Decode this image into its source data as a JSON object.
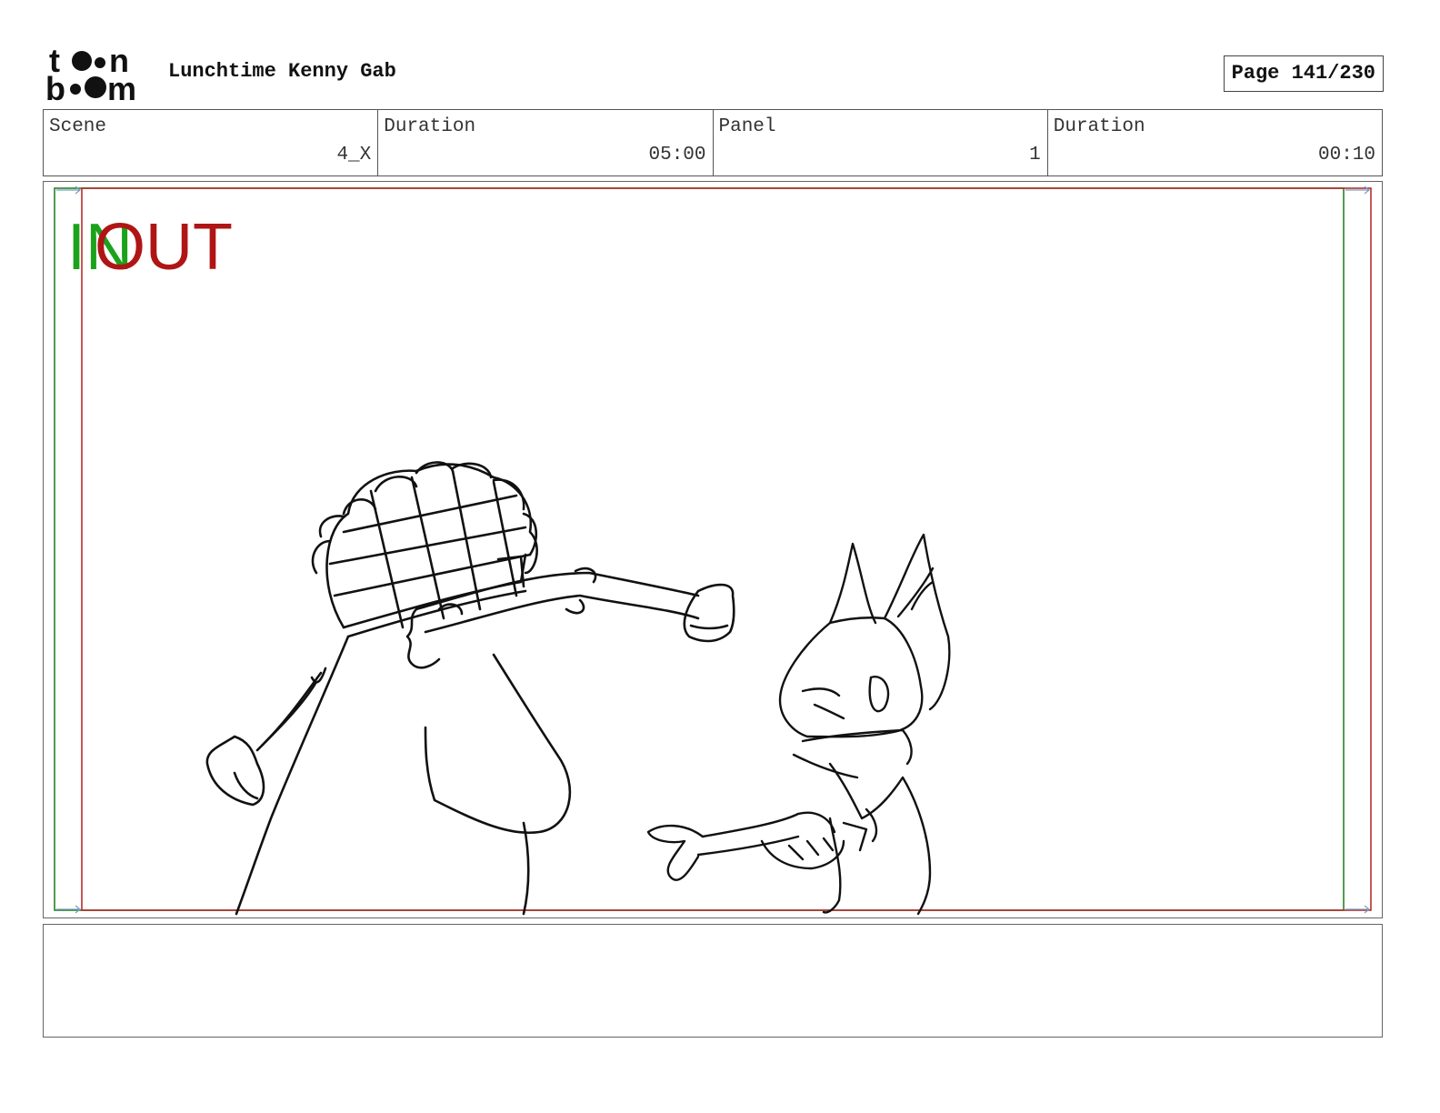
{
  "header": {
    "logo_text_top": "toon",
    "logo_text_bottom": "boom",
    "project_title": "Lunchtime Kenny Gab",
    "page_label": "Page 141/230"
  },
  "info": {
    "scene_label": "Scene",
    "scene_value": "4_X",
    "scene_duration_label": "Duration",
    "scene_duration_value": "05:00",
    "panel_label": "Panel",
    "panel_value": "1",
    "panel_duration_label": "Duration",
    "panel_duration_value": "00:10"
  },
  "panel": {
    "in_marker": "IN",
    "out_marker": "OUT",
    "in_color": "#1aa31a",
    "out_color": "#b01515",
    "in_frame_color": "#1a7a1a",
    "out_frame_color": "#b02020",
    "drawing_icon": "storyboard-sketch"
  },
  "caption": {
    "text": ""
  }
}
